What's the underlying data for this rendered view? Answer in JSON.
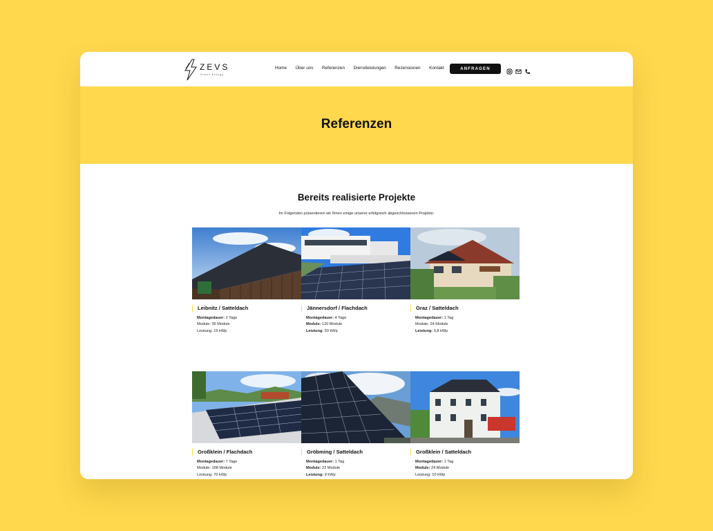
{
  "brand": {
    "name": "ZEVS",
    "tagline": "Green Energy"
  },
  "nav": {
    "items": [
      "Home",
      "Über uns",
      "Referenzen",
      "Dienstleistungen",
      "Rezensionen",
      "Kontakt"
    ],
    "cta_label": "ANFRAGEN",
    "icons": [
      "instagram-icon",
      "mail-icon",
      "phone-icon"
    ]
  },
  "hero": {
    "title": "Referenzen"
  },
  "projects": {
    "title": "Bereits realisierte Projekte",
    "intro": "Im Folgenden präsentieren wir Ihnen einige unserer erfolgreich abgeschlossenen Projekte:",
    "labels": {
      "duration": "Montagedauer:",
      "modules": "Module:",
      "power": "Leistung:"
    },
    "items": [
      {
        "title": "Leibnitz / Satteldach",
        "duration": "2 Tage",
        "modules": "36 Module",
        "power": "15 kWp"
      },
      {
        "title": "Jännersdorf / Flachdach",
        "duration": "4 Tage",
        "modules": "120 Module",
        "power": "50 kWp"
      },
      {
        "title": "Graz / Satteldach",
        "duration": "1 Tag",
        "modules": "24 Module",
        "power": "9,8 kWp"
      },
      {
        "title": "Großklein / Flachdach",
        "duration": "7 Tage",
        "modules": "168 Module",
        "power": "70 kWp"
      },
      {
        "title": "Gröbming / Satteldach",
        "duration": "1 Tag",
        "modules": "22 Module",
        "power": "9 kWp"
      },
      {
        "title": "Großklein / Satteldach",
        "duration": "1 Tag",
        "modules": "24 Module",
        "power": "10 kWp"
      }
    ]
  },
  "colors": {
    "background": "#FFD84D",
    "accent": "#FFD84D",
    "cta_bg": "#111111"
  }
}
